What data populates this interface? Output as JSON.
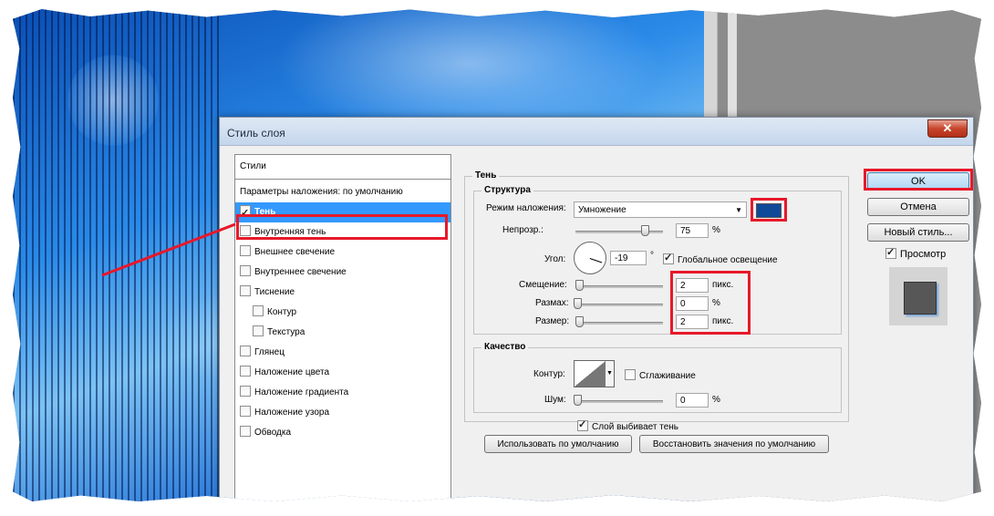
{
  "dialog": {
    "title": "Стиль слоя",
    "close_label": "✕"
  },
  "styles_panel": {
    "header": "Стили",
    "blend_defaults": "Параметры наложения: по умолчанию",
    "items": [
      {
        "label": "Тень",
        "checked": true,
        "selected": true,
        "sub": false
      },
      {
        "label": "Внутренняя тень",
        "checked": false,
        "selected": false,
        "sub": false
      },
      {
        "label": "Внешнее свечение",
        "checked": false,
        "selected": false,
        "sub": false
      },
      {
        "label": "Внутреннее свечение",
        "checked": false,
        "selected": false,
        "sub": false
      },
      {
        "label": "Тиснение",
        "checked": false,
        "selected": false,
        "sub": false
      },
      {
        "label": "Контур",
        "checked": false,
        "selected": false,
        "sub": true
      },
      {
        "label": "Текстура",
        "checked": false,
        "selected": false,
        "sub": true
      },
      {
        "label": "Глянец",
        "checked": false,
        "selected": false,
        "sub": false
      },
      {
        "label": "Наложение цвета",
        "checked": false,
        "selected": false,
        "sub": false
      },
      {
        "label": "Наложение градиента",
        "checked": false,
        "selected": false,
        "sub": false
      },
      {
        "label": "Наложение узора",
        "checked": false,
        "selected": false,
        "sub": false
      },
      {
        "label": "Обводка",
        "checked": false,
        "selected": false,
        "sub": false
      }
    ]
  },
  "shadow": {
    "section_title": "Тень",
    "structure_title": "Структура",
    "blend_mode_label": "Режим наложения:",
    "blend_mode_value": "Умножение",
    "shadow_color": "#0f4a99",
    "opacity_label": "Непрозр.:",
    "opacity_value": "75",
    "opacity_unit": "%",
    "opacity_level": 75,
    "angle_label": "Угол:",
    "angle_value": "-19",
    "angle_unit": "°",
    "global_light_label": "Глобальное освещение",
    "global_light_checked": true,
    "offset_label": "Смещение:",
    "offset_value": "2",
    "offset_unit": "пикс.",
    "spread_label": "Размах:",
    "spread_value": "0",
    "spread_unit": "%",
    "size_label": "Размер:",
    "size_value": "2",
    "size_unit": "пикс.",
    "quality_title": "Качество",
    "contour_label": "Контур:",
    "antialias_label": "Сглаживание",
    "noise_label": "Шум:",
    "noise_value": "0",
    "noise_unit": "%",
    "knockout_label": "Слой выбивает тень",
    "knockout_checked": true,
    "make_default_label": "Использовать по умолчанию",
    "reset_default_label": "Восстановить значения по умолчанию"
  },
  "actions": {
    "ok_label": "OK",
    "cancel_label": "Отмена",
    "new_style_label": "Новый стиль...",
    "preview_label": "Просмотр",
    "preview_checked": true
  },
  "colors": {
    "highlight": "#e8182a",
    "selection": "#3399ff"
  }
}
